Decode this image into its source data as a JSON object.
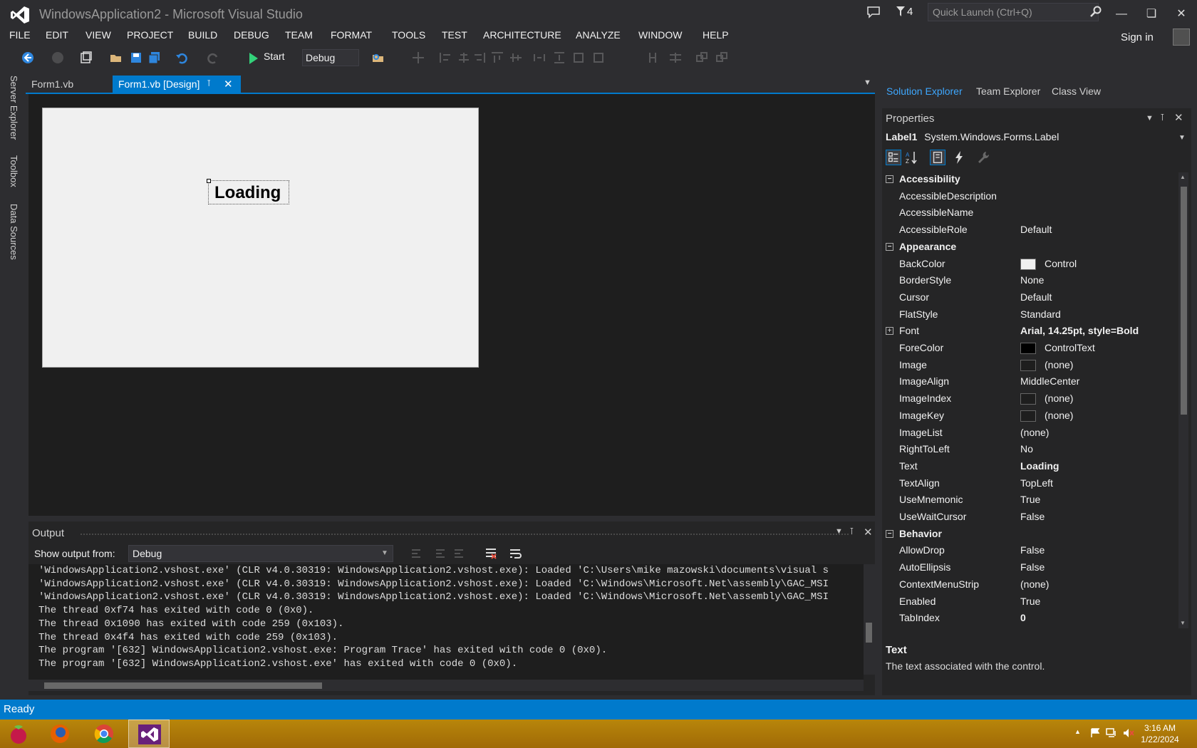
{
  "window": {
    "title": "WindowsApplication2 - Microsoft Visual Studio",
    "notification_count": "4",
    "quick_launch_placeholder": "Quick Launch (Ctrl+Q)",
    "sign_in": "Sign in"
  },
  "menu": [
    "FILE",
    "EDIT",
    "VIEW",
    "PROJECT",
    "BUILD",
    "DEBUG",
    "TEAM",
    "FORMAT",
    "TOOLS",
    "TEST",
    "ARCHITECTURE",
    "ANALYZE",
    "WINDOW",
    "HELP"
  ],
  "toolbar": {
    "start_label": "Start",
    "config_value": "Debug"
  },
  "left_strip": [
    "Server Explorer",
    "Toolbox",
    "Data Sources"
  ],
  "doc_tabs": [
    {
      "label": "Form1.vb",
      "active": false
    },
    {
      "label": "Form1.vb [Design]",
      "active": true
    }
  ],
  "designer": {
    "label_text": "Loading"
  },
  "output": {
    "title": "Output",
    "show_from_label": "Show output from:",
    "show_from_value": "Debug",
    "lines": [
      "'WindowsApplication2.vshost.exe' (CLR v4.0.30319: WindowsApplication2.vshost.exe): Loaded 'C:\\Users\\mike mazowski\\documents\\visual s",
      "'WindowsApplication2.vshost.exe' (CLR v4.0.30319: WindowsApplication2.vshost.exe): Loaded 'C:\\Windows\\Microsoft.Net\\assembly\\GAC_MSI",
      "'WindowsApplication2.vshost.exe' (CLR v4.0.30319: WindowsApplication2.vshost.exe): Loaded 'C:\\Windows\\Microsoft.Net\\assembly\\GAC_MSI",
      "The thread 0xf74 has exited with code 0 (0x0).",
      "The thread 0x1090 has exited with code 259 (0x103).",
      "The thread 0x4f4 has exited with code 259 (0x103).",
      "The program '[632] WindowsApplication2.vshost.exe: Program Trace' has exited with code 0 (0x0).",
      "The program '[632] WindowsApplication2.vshost.exe' has exited with code 0 (0x0)."
    ]
  },
  "solution_tabs": [
    "Solution Explorer",
    "Team Explorer",
    "Class View"
  ],
  "properties": {
    "title": "Properties",
    "object_name": "Label1",
    "object_type": "System.Windows.Forms.Label",
    "rows": [
      {
        "kind": "cat",
        "name": "Accessibility",
        "exp": "−"
      },
      {
        "name": "AccessibleDescription",
        "value": ""
      },
      {
        "name": "AccessibleName",
        "value": ""
      },
      {
        "name": "AccessibleRole",
        "value": "Default"
      },
      {
        "kind": "cat",
        "name": "Appearance",
        "exp": "−"
      },
      {
        "name": "BackColor",
        "value": "Control",
        "swatch": "#f0f0f0"
      },
      {
        "name": "BorderStyle",
        "value": "None"
      },
      {
        "name": "Cursor",
        "value": "Default"
      },
      {
        "name": "FlatStyle",
        "value": "Standard"
      },
      {
        "name": "Font",
        "value": "Arial, 14.25pt, style=Bold",
        "bold": true,
        "exp": "+"
      },
      {
        "name": "ForeColor",
        "value": "ControlText",
        "swatch": "#000000"
      },
      {
        "name": "Image",
        "value": "(none)",
        "swatch": "#1e1e1e"
      },
      {
        "name": "ImageAlign",
        "value": "MiddleCenter"
      },
      {
        "name": "ImageIndex",
        "value": "(none)",
        "swatch": "#1e1e1e"
      },
      {
        "name": "ImageKey",
        "value": "(none)",
        "swatch": "#1e1e1e"
      },
      {
        "name": "ImageList",
        "value": "(none)"
      },
      {
        "name": "RightToLeft",
        "value": "No"
      },
      {
        "name": "Text",
        "value": "Loading",
        "bold": true
      },
      {
        "name": "TextAlign",
        "value": "TopLeft"
      },
      {
        "name": "UseMnemonic",
        "value": "True"
      },
      {
        "name": "UseWaitCursor",
        "value": "False"
      },
      {
        "kind": "cat",
        "name": "Behavior",
        "exp": "−"
      },
      {
        "name": "AllowDrop",
        "value": "False"
      },
      {
        "name": "AutoEllipsis",
        "value": "False"
      },
      {
        "name": "ContextMenuStrip",
        "value": "(none)"
      },
      {
        "name": "Enabled",
        "value": "True"
      },
      {
        "name": "TabIndex",
        "value": "0",
        "bold": true
      }
    ],
    "desc_title": "Text",
    "desc_text": "The text associated with the control."
  },
  "status": "Ready",
  "clock": {
    "time": "3:16 AM",
    "date": "1/22/2024"
  },
  "colors": {
    "accent": "#007acc",
    "play": "#33d17a"
  }
}
